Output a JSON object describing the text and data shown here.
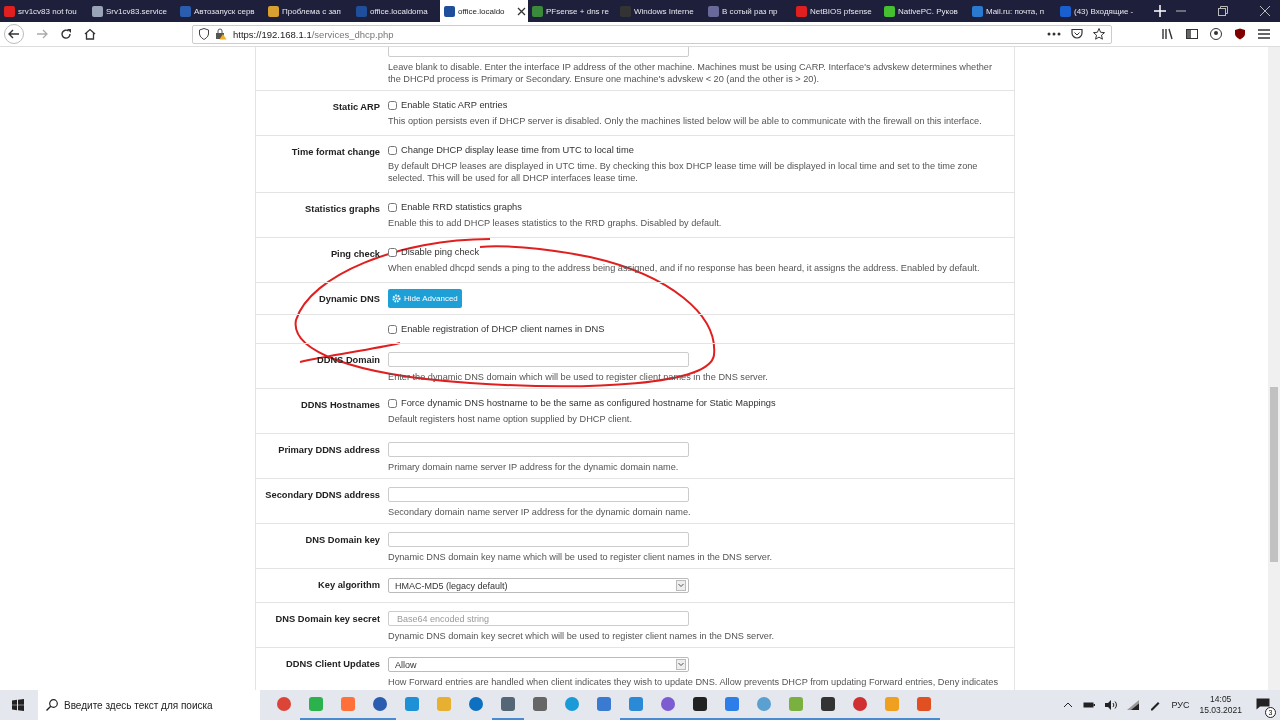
{
  "browser": {
    "tabs": [
      {
        "title": "srv1cv83 not fou",
        "selected": false,
        "color": "#e02020"
      },
      {
        "title": "Srv1cv83.service",
        "selected": false,
        "color": "#9aa4b8"
      },
      {
        "title": "Автозапуск серв",
        "selected": false,
        "color": "#2a5db0"
      },
      {
        "title": "Проблема с зап",
        "selected": false,
        "color": "#d8a030"
      },
      {
        "title": "office.localdoma",
        "selected": false,
        "color": "#1f4f9a"
      },
      {
        "title": "office.localdo",
        "selected": true,
        "color": "#1f4f9a"
      },
      {
        "title": "PFsense + dns re",
        "selected": false,
        "color": "#3b8a3b"
      },
      {
        "title": "Windows Interne",
        "selected": false,
        "color": "#333333"
      },
      {
        "title": "В сотый раз пр",
        "selected": false,
        "color": "#6a6a9a"
      },
      {
        "title": "NetBIOS pfsense",
        "selected": false,
        "color": "#e02020"
      },
      {
        "title": "NativePC. Руков",
        "selected": false,
        "color": "#44c030"
      },
      {
        "title": "Mail.ru: почта, п",
        "selected": false,
        "color": "#2a7ad0"
      },
      {
        "title": "(43) Входящие -",
        "selected": false,
        "color": "#1a5fd0"
      }
    ],
    "url_host": "https://192.168.1.1",
    "url_path": "/services_dhcp.php"
  },
  "form": {
    "rows": [
      {
        "kind": "input",
        "label": "",
        "value": "",
        "help": "Leave blank to disable. Enter the interface IP address of the other machine. Machines must be using CARP. Interface's advskew determines whether the DHCPd process is Primary or Secondary. Ensure one machine's advskew < 20 (and the other is > 20)."
      },
      {
        "kind": "checkbox",
        "label": "Static ARP",
        "text": "Enable Static ARP entries",
        "checked": false,
        "help": "This option persists even if DHCP server is disabled. Only the machines listed below will be able to communicate with the firewall on this interface."
      },
      {
        "kind": "checkbox",
        "label": "Time format change",
        "text": "Change DHCP display lease time from UTC to local time",
        "checked": false,
        "help": "By default DHCP leases are displayed in UTC time. By checking this box DHCP lease time will be displayed in local time and set to the time zone selected. This will be used for all DHCP interfaces lease time."
      },
      {
        "kind": "checkbox",
        "label": "Statistics graphs",
        "text": "Enable RRD statistics graphs",
        "checked": false,
        "help": "Enable this to add DHCP leases statistics to the RRD graphs. Disabled by default."
      },
      {
        "kind": "checkbox",
        "label": "Ping check",
        "text": "Disable ping check",
        "checked": false,
        "help": "When enabled dhcpd sends a ping to the address being assigned, and if no response has been heard, it assigns the address. Enabled by default."
      },
      {
        "kind": "button",
        "label": "Dynamic DNS",
        "text": "Hide Advanced"
      },
      {
        "kind": "checkbox",
        "label": "",
        "text": "Enable registration of DHCP client names in DNS",
        "checked": false
      },
      {
        "kind": "input",
        "label": "DDNS Domain",
        "value": "",
        "help": "Enter the dynamic DNS domain which will be used to register client names in the DNS server."
      },
      {
        "kind": "checkbox",
        "label": "DDNS Hostnames",
        "text": "Force dynamic DNS hostname to be the same as configured hostname for Static Mappings",
        "checked": false,
        "help": "Default registers host name option supplied by DHCP client."
      },
      {
        "kind": "input",
        "label": "Primary DDNS address",
        "value": "",
        "help": "Primary domain name server IP address for the dynamic domain name."
      },
      {
        "kind": "input",
        "label": "Secondary DDNS address",
        "value": "",
        "help": "Secondary domain name server IP address for the dynamic domain name."
      },
      {
        "kind": "input",
        "label": "DNS Domain key",
        "value": "",
        "help": "Dynamic DNS domain key name which will be used to register client names in the DNS server."
      },
      {
        "kind": "select",
        "label": "Key algorithm",
        "value": "HMAC-MD5 (legacy default)"
      },
      {
        "kind": "input",
        "label": "DNS Domain key secret",
        "placeholder": "Base64 encoded string",
        "help": "Dynamic DNS domain key secret which will be used to register client names in the DNS server."
      },
      {
        "kind": "select",
        "label": "DDNS Client Updates",
        "value": "Allow",
        "help": "How Forward entries are handled when client indicates they wish to update DNS. Allow prevents DHCP from updating Forward entries, Deny indicates"
      }
    ]
  },
  "taskbar": {
    "search": {
      "placeholder": "Введите здесь текст для поиска"
    },
    "apps": [
      {
        "color": "#db4437",
        "active": false
      },
      {
        "color": "#2bb24c",
        "active": true
      },
      {
        "color": "#ff7139",
        "active": true
      },
      {
        "color": "#2a5db0",
        "active": true
      },
      {
        "color": "#1e90d6",
        "active": false
      },
      {
        "color": "#e8b030",
        "active": false
      },
      {
        "color": "#0e70c0",
        "active": false
      },
      {
        "color": "#556677",
        "active": true
      },
      {
        "color": "#666666",
        "active": false
      },
      {
        "color": "#1a9ad6",
        "active": false
      },
      {
        "color": "#3a7ad0",
        "active": false
      },
      {
        "color": "#2a8ad6",
        "active": true
      },
      {
        "color": "#7d5bd0",
        "active": true
      },
      {
        "color": "#222222",
        "active": true
      },
      {
        "color": "#2d7ee8",
        "active": true
      },
      {
        "color": "#5aa0d0",
        "active": true
      },
      {
        "color": "#7ab040",
        "active": true
      },
      {
        "color": "#333333",
        "active": true
      },
      {
        "color": "#d03030",
        "active": true
      },
      {
        "color": "#f0a020",
        "active": true
      },
      {
        "color": "#e05020",
        "active": true
      }
    ],
    "lang": "РУС",
    "time": "14:05",
    "date": "15.03.2021",
    "notifications": "3"
  }
}
